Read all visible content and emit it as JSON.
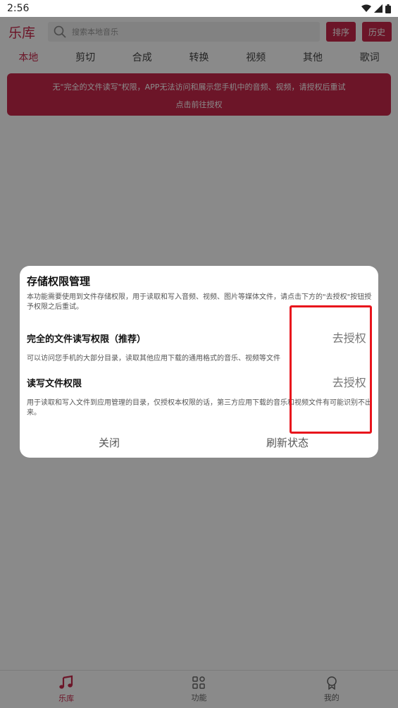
{
  "status_bar": {
    "time": "2:56"
  },
  "header": {
    "brand": "乐库",
    "search_placeholder": "搜索本地音乐",
    "sort_button": "排序",
    "history_button": "历史"
  },
  "tabs": [
    {
      "label": "本地"
    },
    {
      "label": "剪切"
    },
    {
      "label": "合成"
    },
    {
      "label": "转换"
    },
    {
      "label": "视频"
    },
    {
      "label": "其他"
    },
    {
      "label": "歌词"
    }
  ],
  "banner": {
    "line1": "无\"完全的文件读写\"权限，APP无法访问和展示您手机中的音频、视频，请授权后重试",
    "line2": "点击前往授权"
  },
  "dialog": {
    "title": "存储权限管理",
    "description": "本功能需要使用到文件存储权限，用于读取和写入音频、视频、图片等媒体文件，请点击下方的\"去授权\"按钮授予权限之后重试。",
    "permissions": [
      {
        "title": "完全的文件读写权限（推荐）",
        "action": "去授权",
        "description": "可以访问您手机的大部分目录，读取其他应用下载的通用格式的音乐、视频等文件"
      },
      {
        "title": "读写文件权限",
        "action": "去授权",
        "description": "用于读取和写入文件到应用管理的目录，仅授权本权限的话，第三方应用下载的音乐和视频文件有可能识别不出来。"
      }
    ],
    "close_button": "关闭",
    "refresh_button": "刷新状态"
  },
  "bottom_nav": [
    {
      "label": "乐库",
      "icon": "music-note-icon"
    },
    {
      "label": "功能",
      "icon": "grid-icon"
    },
    {
      "label": "我的",
      "icon": "profile-icon"
    }
  ],
  "colors": {
    "accent": "#c8284b",
    "highlight": "#e8141c"
  }
}
